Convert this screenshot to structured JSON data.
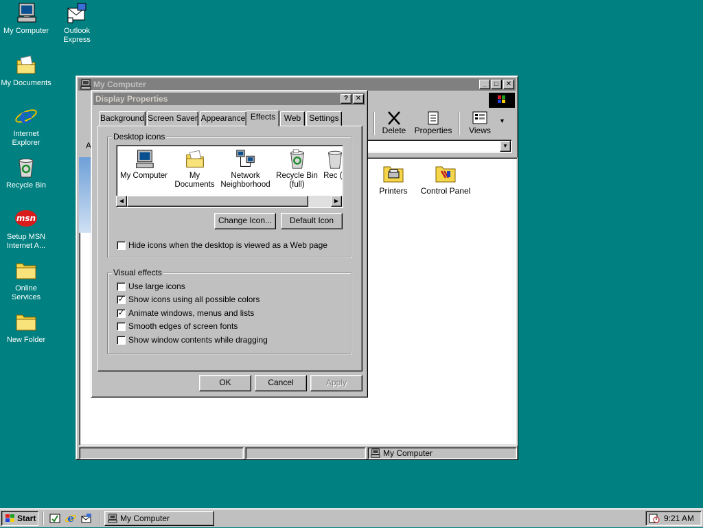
{
  "desktop": {
    "icons": [
      {
        "label": "My Computer"
      },
      {
        "label": "Outlook Express"
      },
      {
        "label": "My Documents"
      },
      {
        "label": "Internet Explorer"
      },
      {
        "label": "Recycle Bin"
      },
      {
        "label": "Setup MSN Internet A..."
      },
      {
        "label": "Online Services"
      },
      {
        "label": "New Folder"
      }
    ]
  },
  "explorer": {
    "title": "My Computer",
    "address_prefix": "A",
    "toolbar": {
      "delete": "Delete",
      "properties": "Properties",
      "views": "Views"
    },
    "items": [
      {
        "label": "Printers"
      },
      {
        "label": "Control Panel"
      }
    ],
    "status": "My Computer"
  },
  "dialog": {
    "title": "Display Properties",
    "help_btn": "?",
    "close_btn": "✕",
    "tabs": [
      "Background",
      "Screen Saver",
      "Appearance",
      "Effects",
      "Web",
      "Settings"
    ],
    "active_tab": "Effects",
    "desktop_icons_group": "Desktop icons",
    "icon_list": [
      {
        "label": "My Computer"
      },
      {
        "label": "My Documents"
      },
      {
        "label": "Network Neighborhood"
      },
      {
        "label": "Recycle Bin (full)"
      },
      {
        "label": "Rec (e"
      }
    ],
    "change_icon": "Change Icon...",
    "default_icon": "Default Icon",
    "hide_icons": {
      "label": "Hide icons when the desktop is viewed as a Web page",
      "checked": false
    },
    "visual_effects_group": "Visual effects",
    "effects": [
      {
        "label": "Use large icons",
        "checked": false
      },
      {
        "label": "Show icons using all possible colors",
        "checked": true
      },
      {
        "label": "Animate windows, menus and lists",
        "checked": true
      },
      {
        "label": "Smooth edges of screen fonts",
        "checked": false
      },
      {
        "label": "Show window contents while dragging",
        "checked": false
      }
    ],
    "ok": "OK",
    "cancel": "Cancel",
    "apply": "Apply"
  },
  "taskbar": {
    "start": "Start",
    "task": "My Computer",
    "clock": "9:21 AM"
  }
}
